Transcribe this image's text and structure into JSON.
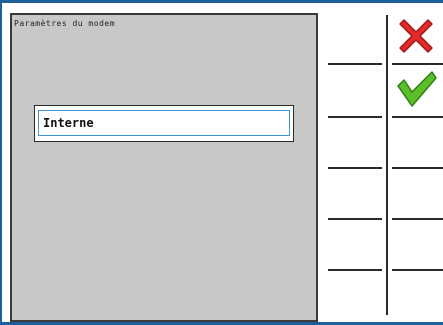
{
  "dialog": {
    "title": "Paramètres du modem",
    "value": "Interne"
  },
  "softkeys": {
    "cancel_icon": "cancel-x-icon",
    "confirm_icon": "checkmark-icon"
  },
  "colors": {
    "frame": "#1f5f97",
    "panel": "#c8c8c8",
    "cancel": "#e32a2a",
    "confirm": "#5cbf2a",
    "focus": "#3f95d1"
  }
}
